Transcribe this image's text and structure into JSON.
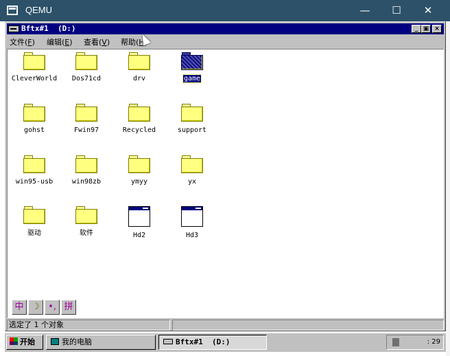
{
  "host": {
    "title": "QEMU",
    "min_glyph": "—",
    "max_glyph": "☐",
    "close_glyph": "✕"
  },
  "window": {
    "title": "Bftx#1  (D:)",
    "min_glyph": "_",
    "max_glyph": "▣",
    "close_glyph": "×",
    "menu": [
      {
        "label": "文件",
        "accel": "F"
      },
      {
        "label": "编辑",
        "accel": "E"
      },
      {
        "label": "查看",
        "accel": "V"
      },
      {
        "label": "帮助",
        "accel": "H"
      }
    ]
  },
  "items": [
    {
      "name": "CleverWorld",
      "icon": "folder-icon",
      "selected": false
    },
    {
      "name": "Dos71cd",
      "icon": "folder-icon",
      "selected": false
    },
    {
      "name": "drv",
      "icon": "folder-icon",
      "selected": false
    },
    {
      "name": "game",
      "icon": "folder-icon",
      "selected": true
    },
    {
      "name": "gohst",
      "icon": "folder-icon",
      "selected": false
    },
    {
      "name": "Fwin97",
      "icon": "folder-icon",
      "selected": false
    },
    {
      "name": "Recycled",
      "icon": "folder-icon",
      "selected": false
    },
    {
      "name": "support",
      "icon": "folder-icon",
      "selected": false
    },
    {
      "name": "win95-usb",
      "icon": "folder-icon",
      "selected": false
    },
    {
      "name": "win98zb",
      "icon": "folder-icon",
      "selected": false
    },
    {
      "name": "ymyy",
      "icon": "folder-icon",
      "selected": false
    },
    {
      "name": "yx",
      "icon": "folder-icon",
      "selected": false
    },
    {
      "name": "驱动",
      "icon": "folder-icon",
      "selected": false
    },
    {
      "name": "软件",
      "icon": "folder-icon",
      "selected": false
    },
    {
      "name": "Hd2",
      "icon": "app-window-icon",
      "selected": false
    },
    {
      "name": "Hd3",
      "icon": "app-window-icon",
      "selected": false
    }
  ],
  "ime": {
    "lang": "中",
    "moon": "☽",
    "punct": "•,",
    "mode": "拼"
  },
  "status": {
    "text": "选定了 1 个对象"
  },
  "taskbar": {
    "start_label": "开始",
    "my_computer_label": "我的电脑",
    "task_label": "Bftx#1  (D:)",
    "clock": ": 29"
  }
}
